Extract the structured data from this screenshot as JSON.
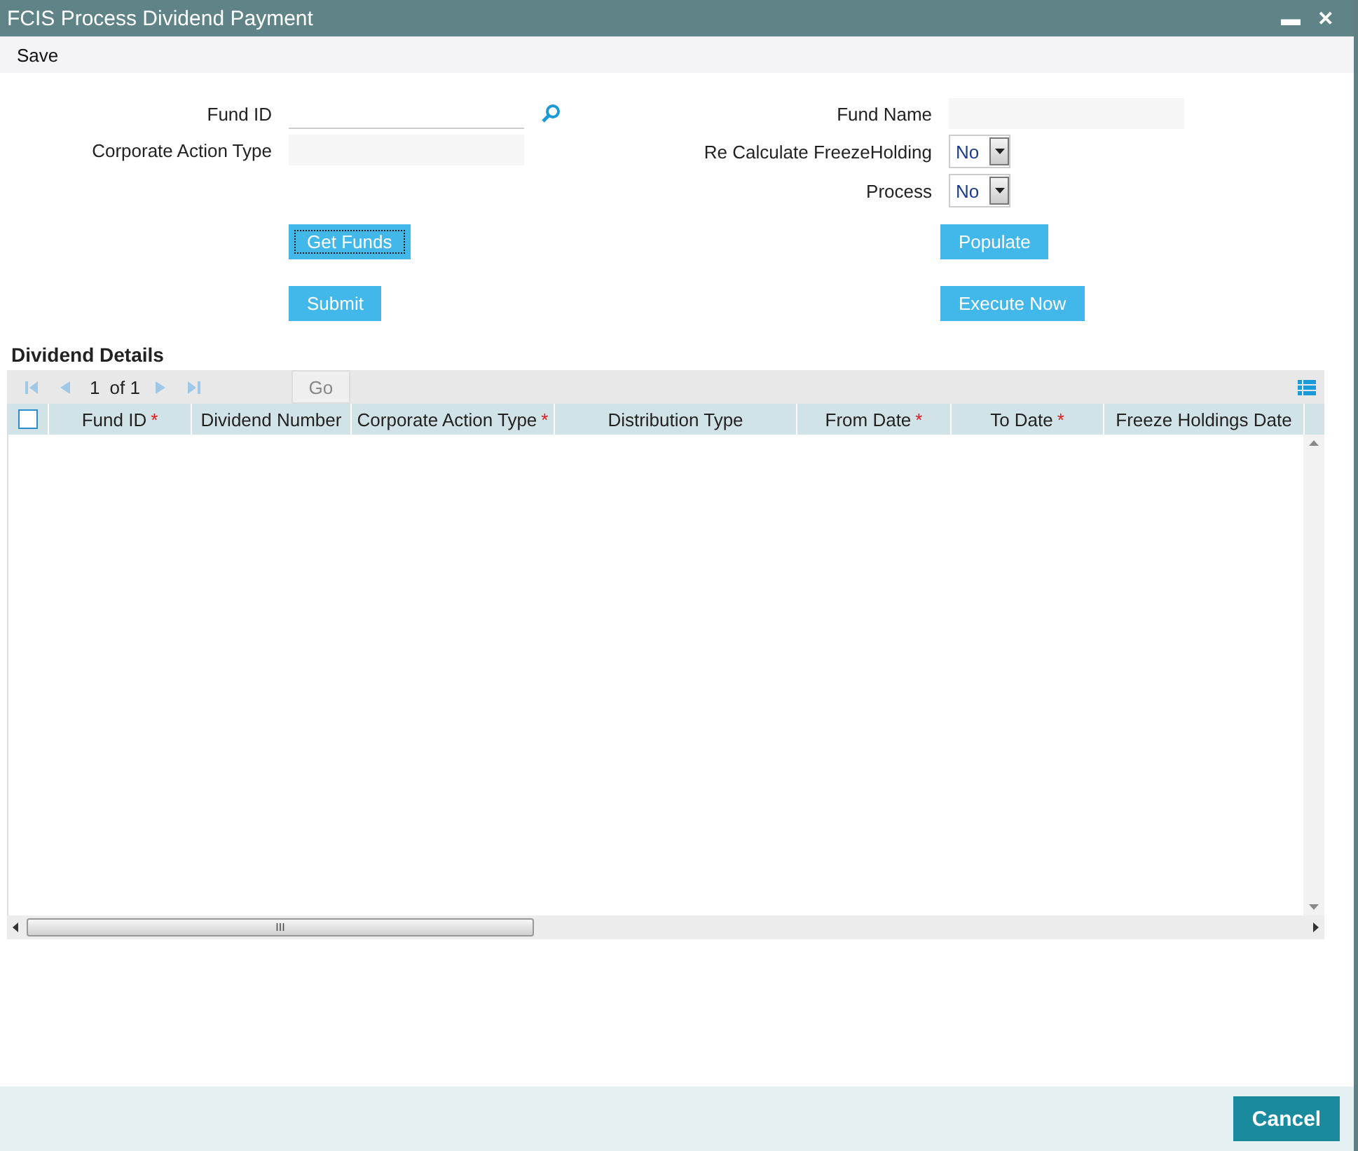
{
  "window": {
    "title": "FCIS Process Dividend Payment",
    "minimize": "▬",
    "close": "✕"
  },
  "menu": [
    "Save"
  ],
  "form": {
    "left": [
      {
        "label": "Fund ID",
        "kind": "lookup"
      },
      {
        "label": "Corporate Action Type",
        "kind": "readonly"
      }
    ],
    "right": [
      {
        "label": "Fund Name",
        "kind": "readonly"
      },
      {
        "label": "Re Calculate FreezeHolding",
        "kind": "select",
        "value": "No"
      },
      {
        "label": "Process",
        "kind": "select",
        "value": "No"
      }
    ]
  },
  "buttons": [
    {
      "label": "Get Funds",
      "focused": true
    },
    {
      "label": "Populate",
      "focused": false
    },
    {
      "label": "Submit",
      "focused": false
    },
    {
      "label": "Execute Now",
      "focused": false
    }
  ],
  "grid": {
    "title": "Dividend Details",
    "pager": {
      "page": "1",
      "of": "of 1",
      "go": "Go"
    },
    "select_all_checked": false,
    "columns": [
      {
        "label": "Fund ID",
        "required_mark": "*"
      },
      {
        "label": "Dividend Number"
      },
      {
        "label": "Corporate Action Type",
        "required_mark": "*"
      },
      {
        "label": "Distribution Type"
      },
      {
        "label": "From Date",
        "required_mark": "*"
      },
      {
        "label": "To Date",
        "required_mark": "*"
      },
      {
        "label": "Freeze Holdings Date"
      }
    ],
    "scroll_thumb_label": "III"
  },
  "footer": {
    "cancel": "Cancel"
  }
}
